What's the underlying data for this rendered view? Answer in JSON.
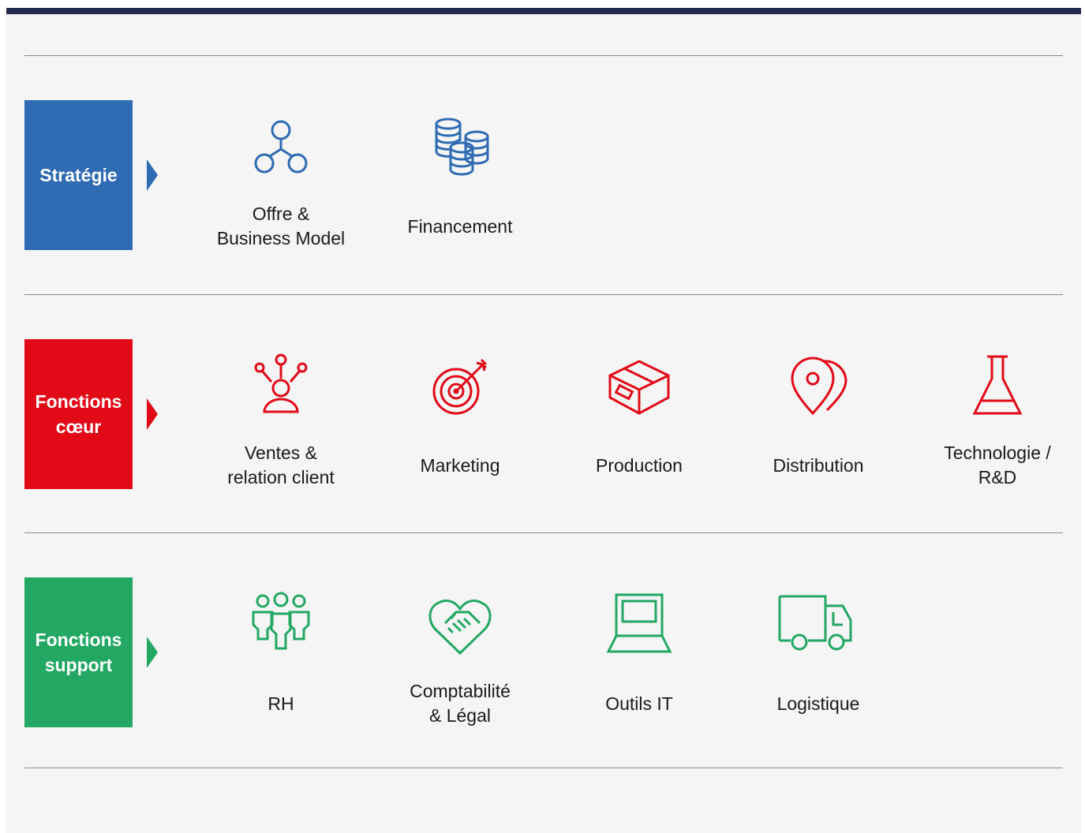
{
  "colors": {
    "top_bar": "#232a4e",
    "strategie": "#2e6bb3",
    "coeur": "#e20a17",
    "support": "#22a862"
  },
  "rows": [
    {
      "category": [
        "Stratégie"
      ],
      "items": [
        {
          "icon": "network-nodes-icon",
          "label": [
            "Offre &",
            "Business Model"
          ]
        },
        {
          "icon": "coin-stacks-icon",
          "label": [
            "Financement"
          ]
        }
      ]
    },
    {
      "category": [
        "Fonctions",
        "cœur"
      ],
      "items": [
        {
          "icon": "customer-network-icon",
          "label": [
            "Ventes &",
            "relation client"
          ]
        },
        {
          "icon": "target-arrow-icon",
          "label": [
            "Marketing"
          ]
        },
        {
          "icon": "box-icon",
          "label": [
            "Production"
          ]
        },
        {
          "icon": "map-pins-icon",
          "label": [
            "Distribution"
          ]
        },
        {
          "icon": "flask-icon",
          "label": [
            "Technologie /",
            "R&D"
          ]
        }
      ]
    },
    {
      "category": [
        "Fonctions",
        "support"
      ],
      "items": [
        {
          "icon": "team-icon",
          "label": [
            "RH"
          ]
        },
        {
          "icon": "handshake-heart-icon",
          "label": [
            "Comptabilité",
            "& Légal"
          ]
        },
        {
          "icon": "laptop-icon",
          "label": [
            "Outils IT"
          ]
        },
        {
          "icon": "truck-icon",
          "label": [
            "Logistique"
          ]
        }
      ]
    }
  ]
}
